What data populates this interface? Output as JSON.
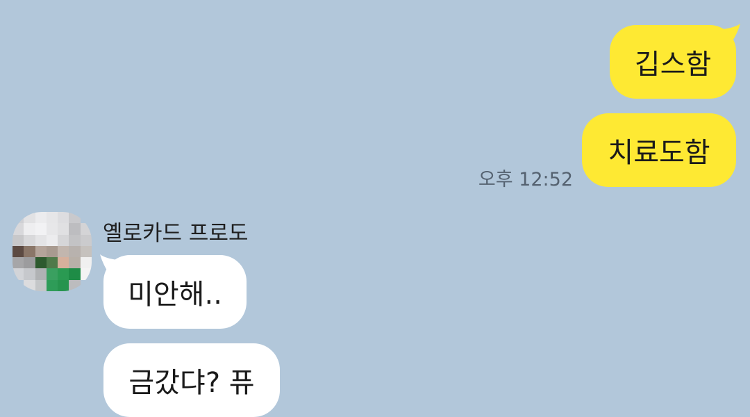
{
  "colors": {
    "background": "#b2c7da",
    "my_bubble": "#fee933",
    "their_bubble": "#ffffff",
    "timestamp_text": "#556270"
  },
  "messages_mine": [
    {
      "text": "깁스함"
    },
    {
      "text": "치료도함"
    }
  ],
  "mine_timestamp": "오후 12:52",
  "other_sender": {
    "name": "옐로카드 프로도",
    "avatar": "pixelated-profile-avatar"
  },
  "messages_theirs": [
    {
      "text": "미안해.."
    },
    {
      "text": "금갔댜? 퓨"
    }
  ]
}
